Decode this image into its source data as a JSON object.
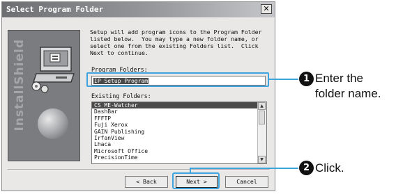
{
  "dialog": {
    "title": "Select Program Folder",
    "close_icon_glyph": "✕",
    "side_brand": "InstallShield",
    "intro_text": "Setup will add program icons to the Program Folder\nlisted below.  You may type a new folder name, or\nselect one from the existing Folders list.  Click\nNext to continue.",
    "program_folders_label": "Program Folders:",
    "program_folder_value": "IP Setup Program",
    "existing_folders_label": "Existing Folders:",
    "existing_folders": [
      "CS ME-Watcher",
      "DashBar",
      "FFFTP",
      "Fuji Xerox",
      "GAIN Publishing",
      "IrfanView",
      "Lhaca",
      "Microsoft Office",
      "PrecisionTime"
    ],
    "selected_folder": "CS ME-Watcher",
    "buttons": {
      "back": "< Back",
      "next": "Next >",
      "cancel": "Cancel"
    }
  },
  "callouts": [
    {
      "number": "1",
      "text": "Enter the\nfolder name."
    },
    {
      "number": "2",
      "text": "Click."
    }
  ],
  "colors": {
    "callout_accent": "#3fa4de",
    "title_bar": "#6d6e71",
    "dialog_face": "#e9e8e6"
  }
}
